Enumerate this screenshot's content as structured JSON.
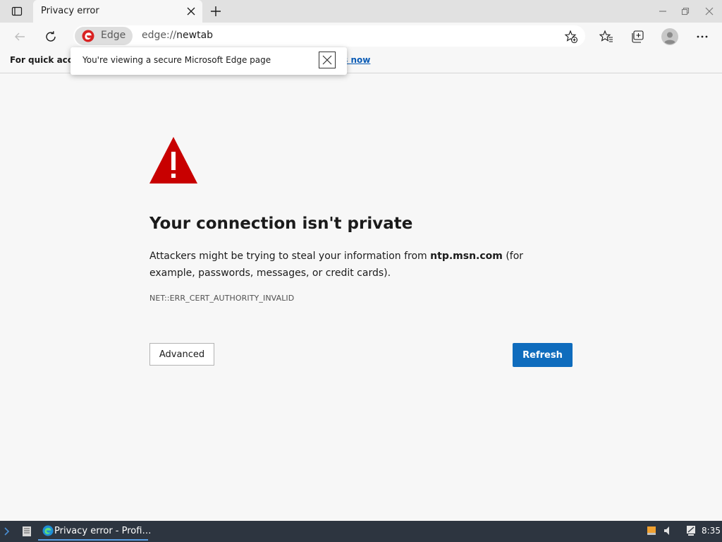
{
  "tab": {
    "title": "Privacy error"
  },
  "address": {
    "badge_label": "Edge",
    "url_scheme": "edge://",
    "url_host": "newtab"
  },
  "favorites_bar": {
    "text": "For quick acce",
    "link": "es now"
  },
  "popup": {
    "text": "You're viewing a secure Microsoft Edge page"
  },
  "error": {
    "heading": "Your connection isn't private",
    "desc_before": "Attackers might be trying to steal your information from ",
    "desc_host": "ntp.msn.com",
    "desc_after": " (for example, passwords, messages, or credit cards).",
    "code": "NET::ERR_CERT_AUTHORITY_INVALID",
    "advanced_label": "Advanced",
    "refresh_label": "Refresh"
  },
  "taskbar": {
    "window_label": "Privacy error - Profi…",
    "clock": "8:35"
  },
  "icons": {
    "tab_actions": "tab-actions-icon",
    "tab_close": "close-icon",
    "new_tab": "plus-icon",
    "minimize": "minimize-icon",
    "restore": "restore-icon",
    "close": "close-icon",
    "back": "back-arrow-icon",
    "reload": "reload-icon",
    "add_favorite": "star-plus-icon",
    "favorites": "favorites-icon",
    "collections": "collections-icon",
    "profile": "profile-icon",
    "more": "more-icon",
    "warning": "warning-triangle-icon"
  },
  "colors": {
    "accent": "#0f6cbd",
    "warning": "#c80000",
    "edge_badge": "#d92222",
    "taskbar": "#2d3540"
  }
}
